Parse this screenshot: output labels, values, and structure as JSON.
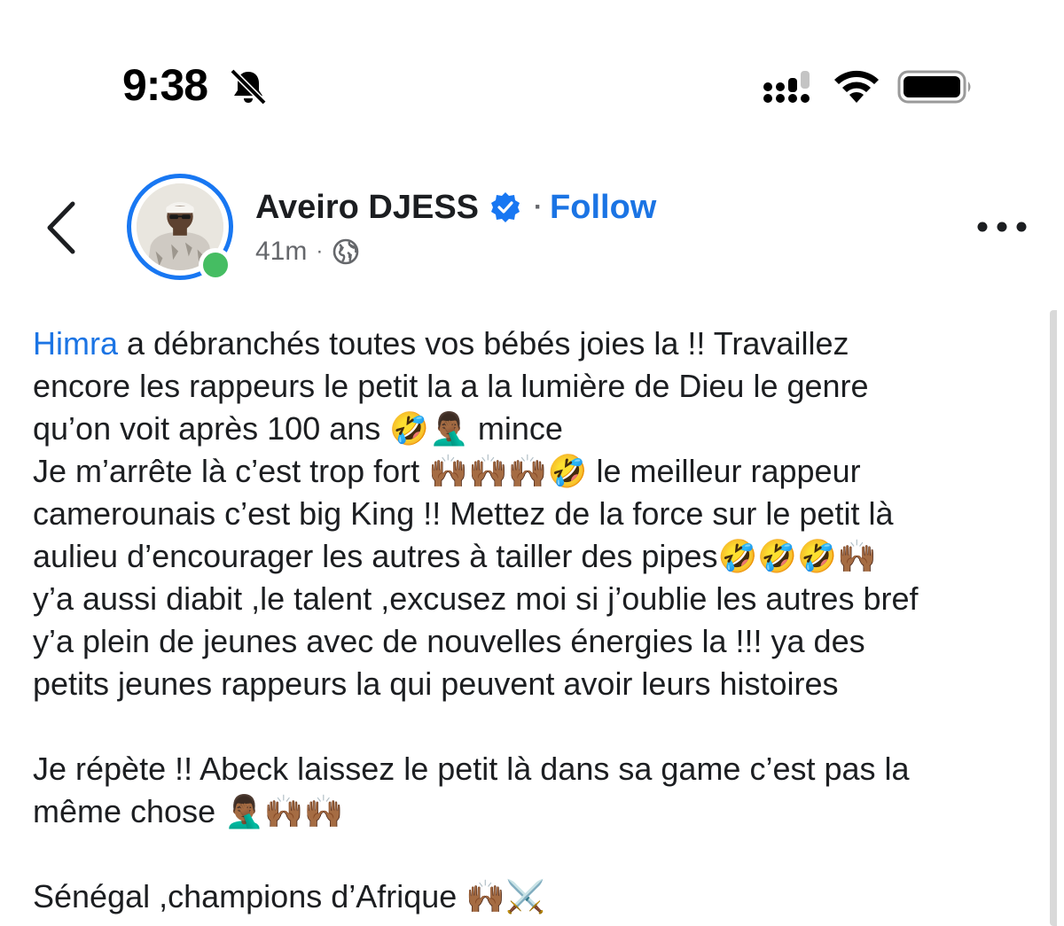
{
  "status_bar": {
    "time": "9:38",
    "icons": [
      "bell-slash-icon",
      "cellular-signal-icon",
      "wifi-icon",
      "battery-icon"
    ]
  },
  "header": {
    "back_icon": "chevron-left-icon",
    "author_name": "Aveiro DJESS",
    "verified_icon": "verified-badge-icon",
    "separator": "·",
    "follow_label": "Follow",
    "timestamp": "41m",
    "meta_separator": "·",
    "privacy_icon": "globe-icon",
    "more_icon": "more-horizontal-icon",
    "online_status": "online"
  },
  "post": {
    "mention": "Himra",
    "line1_rest": " a débranchés toutes vos bébés joies la !! Travaillez",
    "line2": "encore les rappeurs le petit la a la lumière de Dieu le genre",
    "line3": "qu’on voit après 100 ans 🤣🤦🏾‍♂️ mince",
    "line4": "Je m’arrête là c’est trop fort 🙌🏾🙌🏾🙌🏾🤣 le meilleur rappeur",
    "line5": "camerounais c’est big King !! Mettez de la force sur le petit là",
    "line6": "aulieu d’encourager les autres à tailler des pipes🤣🤣🤣🙌🏾",
    "line7": "y’a aussi diabit ,le talent ,excusez moi si j’oublie les autres bref",
    "line8": "y’a plein de jeunes avec de nouvelles énergies la !!! ya des",
    "line9": "petits jeunes rappeurs la qui peuvent avoir leurs histoires",
    "line10": "Je répète !! Abeck laissez le petit là dans sa game c’est pas la",
    "line11": "même chose 🤦🏾‍♂️🙌🏾🙌🏾",
    "line12": "Sénégal ,champions d’Afrique 🙌🏾⚔️"
  },
  "colors": {
    "link_blue": "#1b74e4",
    "online_green": "#45bd62",
    "text_primary": "#1c1e21",
    "text_secondary": "#65676b"
  }
}
